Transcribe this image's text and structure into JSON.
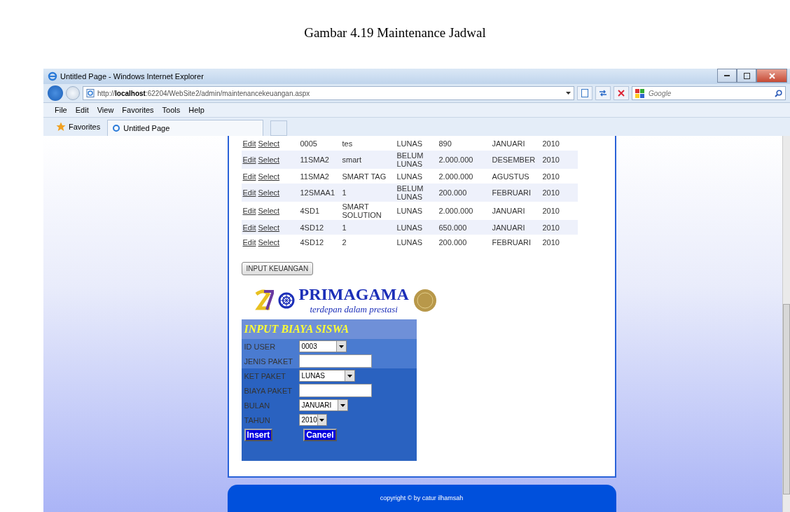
{
  "caption": "Gambar 4.19 Maintenance Jadwal",
  "window": {
    "title": "Untitled Page - Windows Internet Explorer"
  },
  "address_bar": {
    "url": "http://**localhost**:62204/WebSite2/admin/maintenancekeuangan.aspx"
  },
  "search": {
    "placeholder": "Google"
  },
  "menu": [
    "File",
    "Edit",
    "View",
    "Favorites",
    "Tools",
    "Help"
  ],
  "favorites_bar": {
    "label": "Favorites",
    "tab": "Untitled Page"
  },
  "table": {
    "rows": [
      {
        "edit": "Edit",
        "select": "Select",
        "id": "0005",
        "paket": "tes",
        "ket": "LUNAS",
        "biaya": "890",
        "bulan": "JANUARI",
        "tahun": "2010"
      },
      {
        "edit": "Edit",
        "select": "Select",
        "id": "11SMA2",
        "paket": "smart",
        "ket": "BELUM LUNAS",
        "biaya": "2.000.000",
        "bulan": "DESEMBER",
        "tahun": "2010"
      },
      {
        "edit": "Edit",
        "select": "Select",
        "id": "11SMA2",
        "paket": "SMART TAG",
        "ket": "LUNAS",
        "biaya": "2.000.000",
        "bulan": "AGUSTUS",
        "tahun": "2010"
      },
      {
        "edit": "Edit",
        "select": "Select",
        "id": "12SMAA1",
        "paket": "1",
        "ket": "BELUM LUNAS",
        "biaya": "200.000",
        "bulan": "FEBRUARI",
        "tahun": "2010"
      },
      {
        "edit": "Edit",
        "select": "Select",
        "id": "4SD1",
        "paket": "SMART SOLUTION",
        "ket": "LUNAS",
        "biaya": "2.000.000",
        "bulan": "JANUARI",
        "tahun": "2010"
      },
      {
        "edit": "Edit",
        "select": "Select",
        "id": "4SD12",
        "paket": "1",
        "ket": "LUNAS",
        "biaya": "650.000",
        "bulan": "JANUARI",
        "tahun": "2010"
      },
      {
        "edit": "Edit",
        "select": "Select",
        "id": "4SD12",
        "paket": "2",
        "ket": "LUNAS",
        "biaya": "200.000",
        "bulan": "FEBRUARI",
        "tahun": "2010"
      }
    ]
  },
  "input_button": "INPUT KEUANGAN",
  "brand": {
    "name": "PRIMAGAMA",
    "tagline": "terdepan dalam prestasi"
  },
  "form": {
    "title": "INPUT BIAYA SISWA",
    "fields": [
      {
        "label": "ID USER",
        "kind": "select",
        "value": "0003"
      },
      {
        "label": "JENIS PAKET",
        "kind": "text"
      },
      {
        "label": "KET PAKET",
        "kind": "select",
        "value": "LUNAS"
      },
      {
        "label": "BIAYA PAKET",
        "kind": "text"
      },
      {
        "label": "BULAN",
        "kind": "select",
        "value": "JANUARI"
      },
      {
        "label": "TAHUN",
        "kind": "select",
        "value": "2010"
      }
    ],
    "buttons": [
      "Insert",
      "Cancel"
    ]
  },
  "footer": "copyright © by catur ilhamsah"
}
